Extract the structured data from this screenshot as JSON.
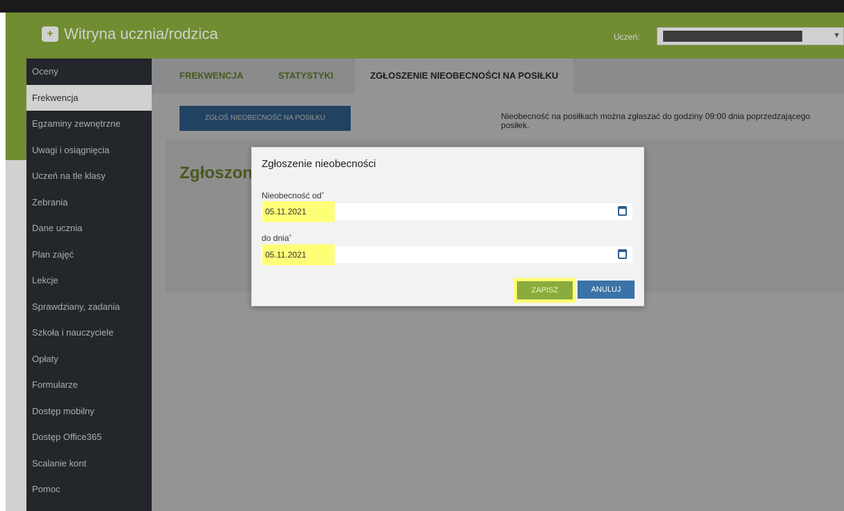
{
  "header": {
    "title": "Witryna ucznia/rodzica",
    "student_label": "Uczeń:",
    "student_value": ""
  },
  "sidebar": {
    "items": [
      {
        "label": "Oceny",
        "active": false
      },
      {
        "label": "Frekwencja",
        "active": true
      },
      {
        "label": "Egzaminy zewnętrzne",
        "active": false
      },
      {
        "label": "Uwagi i osiągnięcia",
        "active": false
      },
      {
        "label": "Uczeń na tle klasy",
        "active": false
      },
      {
        "label": "Zebrania",
        "active": false
      },
      {
        "label": "Dane ucznia",
        "active": false
      },
      {
        "label": "Plan zajęć",
        "active": false
      },
      {
        "label": "Lekcje",
        "active": false
      },
      {
        "label": "Sprawdziany, zadania",
        "active": false
      },
      {
        "label": "Szkoła i nauczyciele",
        "active": false
      },
      {
        "label": "Opłaty",
        "active": false
      },
      {
        "label": "Formularze",
        "active": false
      },
      {
        "label": "Dostęp mobilny",
        "active": false
      },
      {
        "label": "Dostęp Office365",
        "active": false
      },
      {
        "label": "Scalanie kont",
        "active": false
      },
      {
        "label": "Pomoc",
        "active": false
      }
    ]
  },
  "tabs": [
    {
      "label": "FREKWENCJA",
      "active": false
    },
    {
      "label": "STATYSTYKI",
      "active": false
    },
    {
      "label": "ZGŁOSZENIE NIEOBECNOŚCI NA POSIŁKU",
      "active": true
    }
  ],
  "main": {
    "report_button": "ZGŁOŚ NIEOBECNOŚĆ NA POSIŁKU",
    "notice": "Nieobecność na posiłkach można zgłaszać do godziny 09:00 dnia poprzedzającego posiłek.",
    "section_title": "Zgłoszon"
  },
  "modal": {
    "title": "Zgłoszenie nieobecności",
    "from_label": "Nieobecność od",
    "from_value": "05.11.2021",
    "to_label": "do dnia",
    "to_value": "05.11.2021",
    "required_mark": "*",
    "save_label": "ZAPISZ",
    "cancel_label": "ANULUJ"
  },
  "colors": {
    "brand_green": "#8aac3c",
    "sidebar_bg": "#2b2f35",
    "primary_blue": "#3b73a8",
    "highlight": "#fffe77"
  }
}
